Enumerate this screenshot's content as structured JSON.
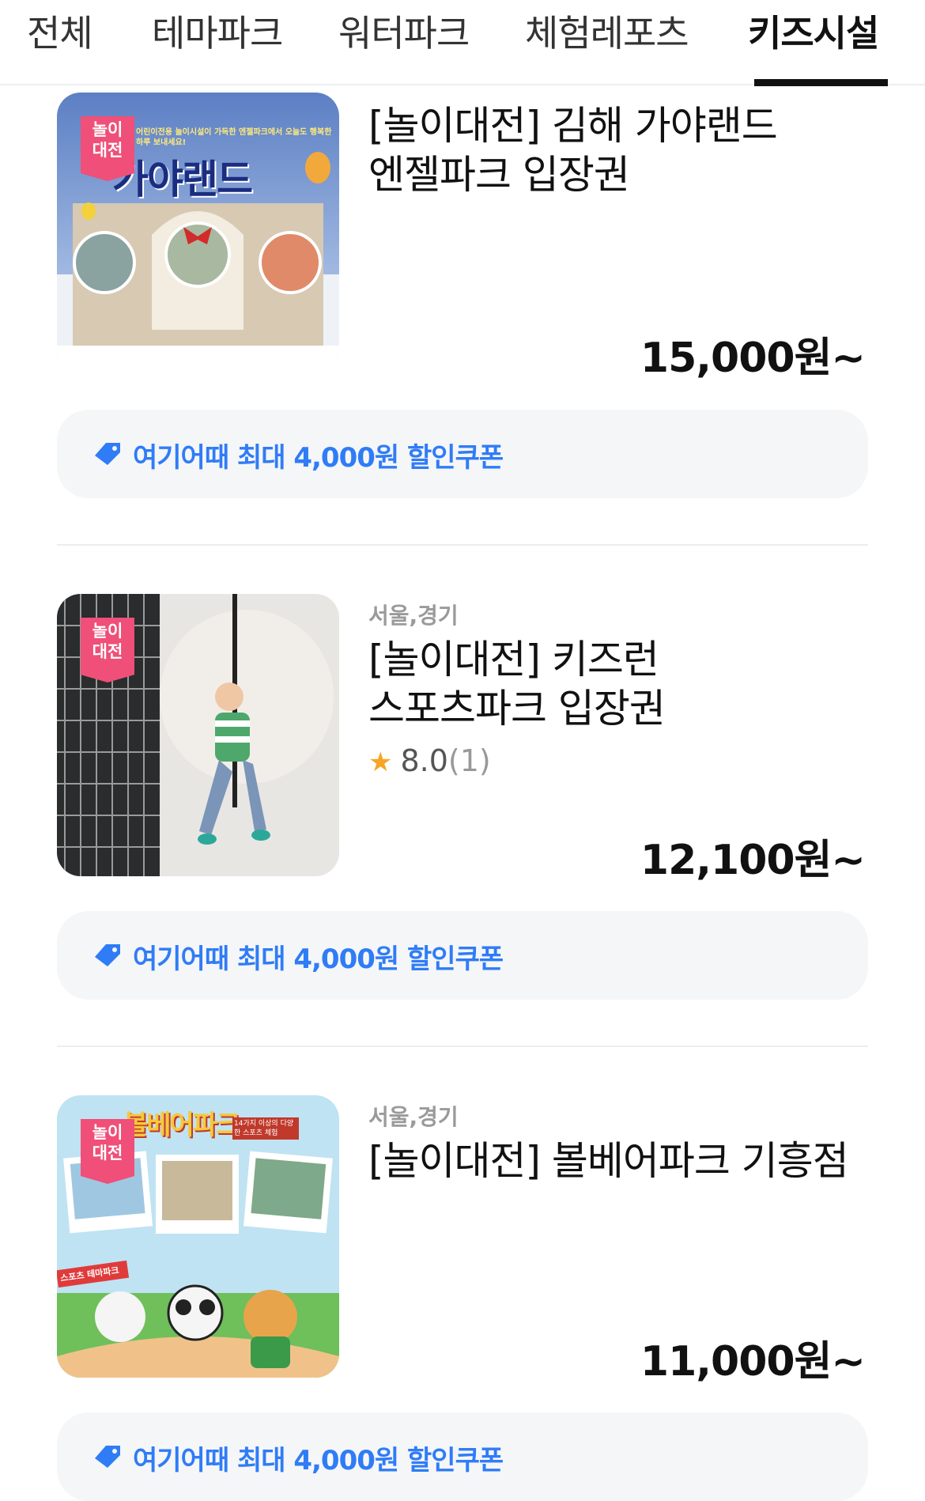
{
  "tabs": [
    "전체",
    "테마파크",
    "워터파크",
    "체험레포츠",
    "키즈시설"
  ],
  "active_tab": "키즈시설",
  "coupon_text": "여기어때 최대 4,000원 할인쿠폰",
  "badge_lines": [
    "놀이",
    "대전"
  ],
  "products": [
    {
      "region": "",
      "title_line1": "[놀이대전] 김해 가야랜드",
      "title_line2": "엔젤파크 입장권",
      "price": "15,000원~",
      "thumb_text": "가야랜드",
      "thumb_caption": "어린이전용 놀이시설이 가득한 엔젤파크에서 오늘도 행복한 하루 보내세요!"
    },
    {
      "region": "서울,경기",
      "title_line1": "[놀이대전] 키즈런",
      "title_line2": "스포츠파크 입장권",
      "rating": "8.0",
      "rating_count": "(1)",
      "price": "12,100원~"
    },
    {
      "region": "서울,경기",
      "title_line1": "[놀이대전] 볼베어파크 기흥점",
      "title_line2": "",
      "price": "11,000원~",
      "thumb_text": "볼베어파크",
      "thumb_caption": "14가지 이상의 다양한 스포츠 체험",
      "thumb_label": "스포츠 테마파크"
    }
  ],
  "colors": {
    "coupon_blue": "#2f7cf6",
    "badge_pink": "#ef4f78",
    "star": "#f6a623"
  }
}
